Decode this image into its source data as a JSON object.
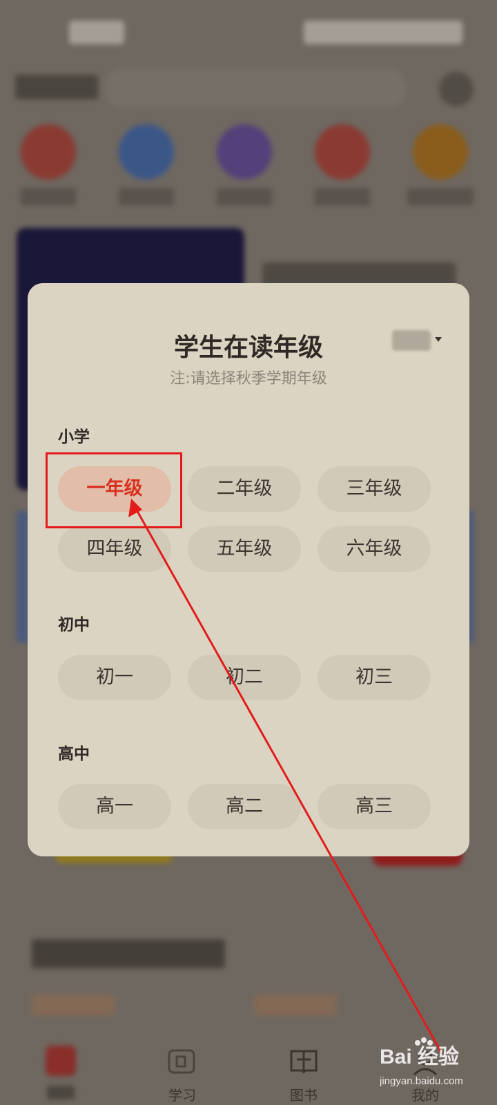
{
  "modal": {
    "title": "学生在读年级",
    "subtitle": "注:请选择秋季学期年级"
  },
  "sections": [
    {
      "label": "小学",
      "grades": [
        "一年级",
        "二年级",
        "三年级",
        "四年级",
        "五年级",
        "六年级"
      ]
    },
    {
      "label": "初中",
      "grades": [
        "初一",
        "初二",
        "初三"
      ]
    },
    {
      "label": "高中",
      "grades": [
        "高一",
        "高二",
        "高三"
      ]
    }
  ],
  "selected_grade": "一年级",
  "bottom_nav": {
    "items": [
      {
        "label": "",
        "icon": "home-icon"
      },
      {
        "label": "学习",
        "icon": "study-icon"
      },
      {
        "label": "图书",
        "icon": "book-icon"
      },
      {
        "label": "我的",
        "icon": "profile-icon"
      }
    ]
  },
  "watermark": {
    "brand": "Bai 经验",
    "url": "jingyan.baidu.com"
  },
  "colors": {
    "accent_red": "#e31b1b",
    "selected_text": "#d92f1e",
    "modal_bg": "#dbd4c3",
    "overlay": "#6f6861"
  }
}
